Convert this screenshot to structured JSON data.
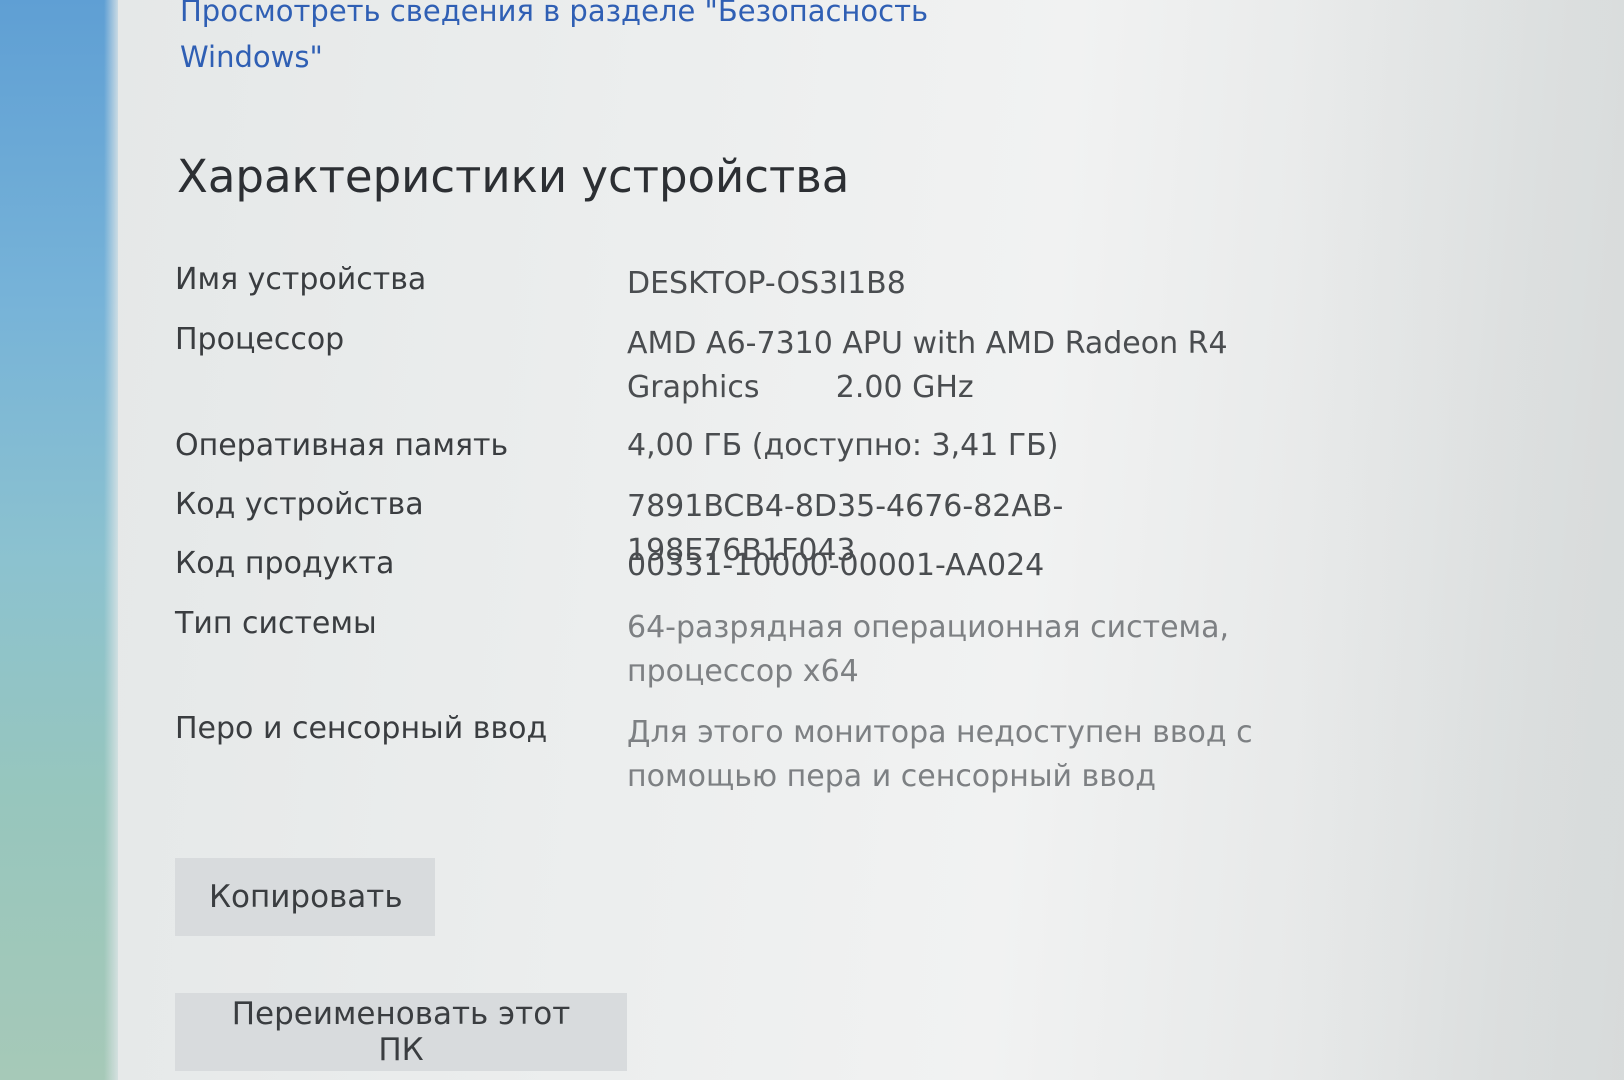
{
  "security_link": {
    "text": "Просмотреть сведения в разделе \"Безопасность Windows\""
  },
  "section": {
    "title": "Характеристики устройства"
  },
  "specs": [
    {
      "label": "Имя устройства",
      "value": "DESKTOP-OS3I1B8"
    },
    {
      "label": "Процессор",
      "value": "AMD A6-7310 APU with AMD Radeon R4 Graphics        2.00 GHz"
    },
    {
      "label": "Оперативная память",
      "value": "4,00 ГБ (доступно: 3,41 ГБ)"
    },
    {
      "label": "Код устройства",
      "value": "7891BCB4-8D35-4676-82AB-198E76B1F043"
    },
    {
      "label": "Код продукта",
      "value": "00331-10000-00001-AA024"
    },
    {
      "label": "Тип системы",
      "value": "64-разрядная операционная система, процессор x64"
    },
    {
      "label": "Перо и сенсорный ввод",
      "value": "Для этого монитора недоступен ввод с помощью пера и сенсорный ввод"
    }
  ],
  "buttons": {
    "copy": "Копировать",
    "rename": "Переименовать этот ПК"
  }
}
